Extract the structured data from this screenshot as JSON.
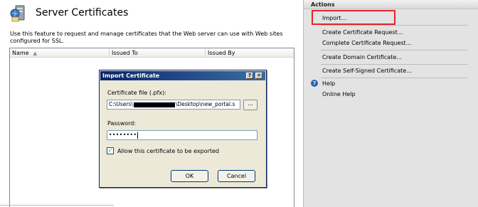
{
  "feature": {
    "title": "Server Certificates",
    "description": "Use this feature to request and manage certificates that the Web server can use with Web sites configured for SSL.",
    "icon": "server-certificate-icon",
    "columns": [
      "Name",
      "Issued To",
      "Issued By"
    ],
    "sort_indicator": "▲"
  },
  "dialog": {
    "title": "Import Certificate",
    "help_glyph": "?",
    "close_glyph": "✕",
    "file_label": "Certificate file (.pfx):",
    "file_value_prefix": "C:\\Users\\",
    "file_value_suffix": "\\Desktop\\new_portal.s",
    "browse_label": "...",
    "password_label": "Password:",
    "password_value": "••••••••",
    "allow_export_label": "Allow this certificate to be exported",
    "allow_export_checked": true,
    "check_glyph": "✓",
    "ok_label": "OK",
    "cancel_label": "Cancel"
  },
  "actions": {
    "title": "Actions",
    "items": [
      "Import...",
      "Create Certificate Request...",
      "Complete Certificate Request...",
      "Create Domain Certificate...",
      "Create Self-Signed Certificate...",
      "Help",
      "Online Help"
    ],
    "help_icon": "help-icon",
    "highlight_color": "#e0262c"
  }
}
